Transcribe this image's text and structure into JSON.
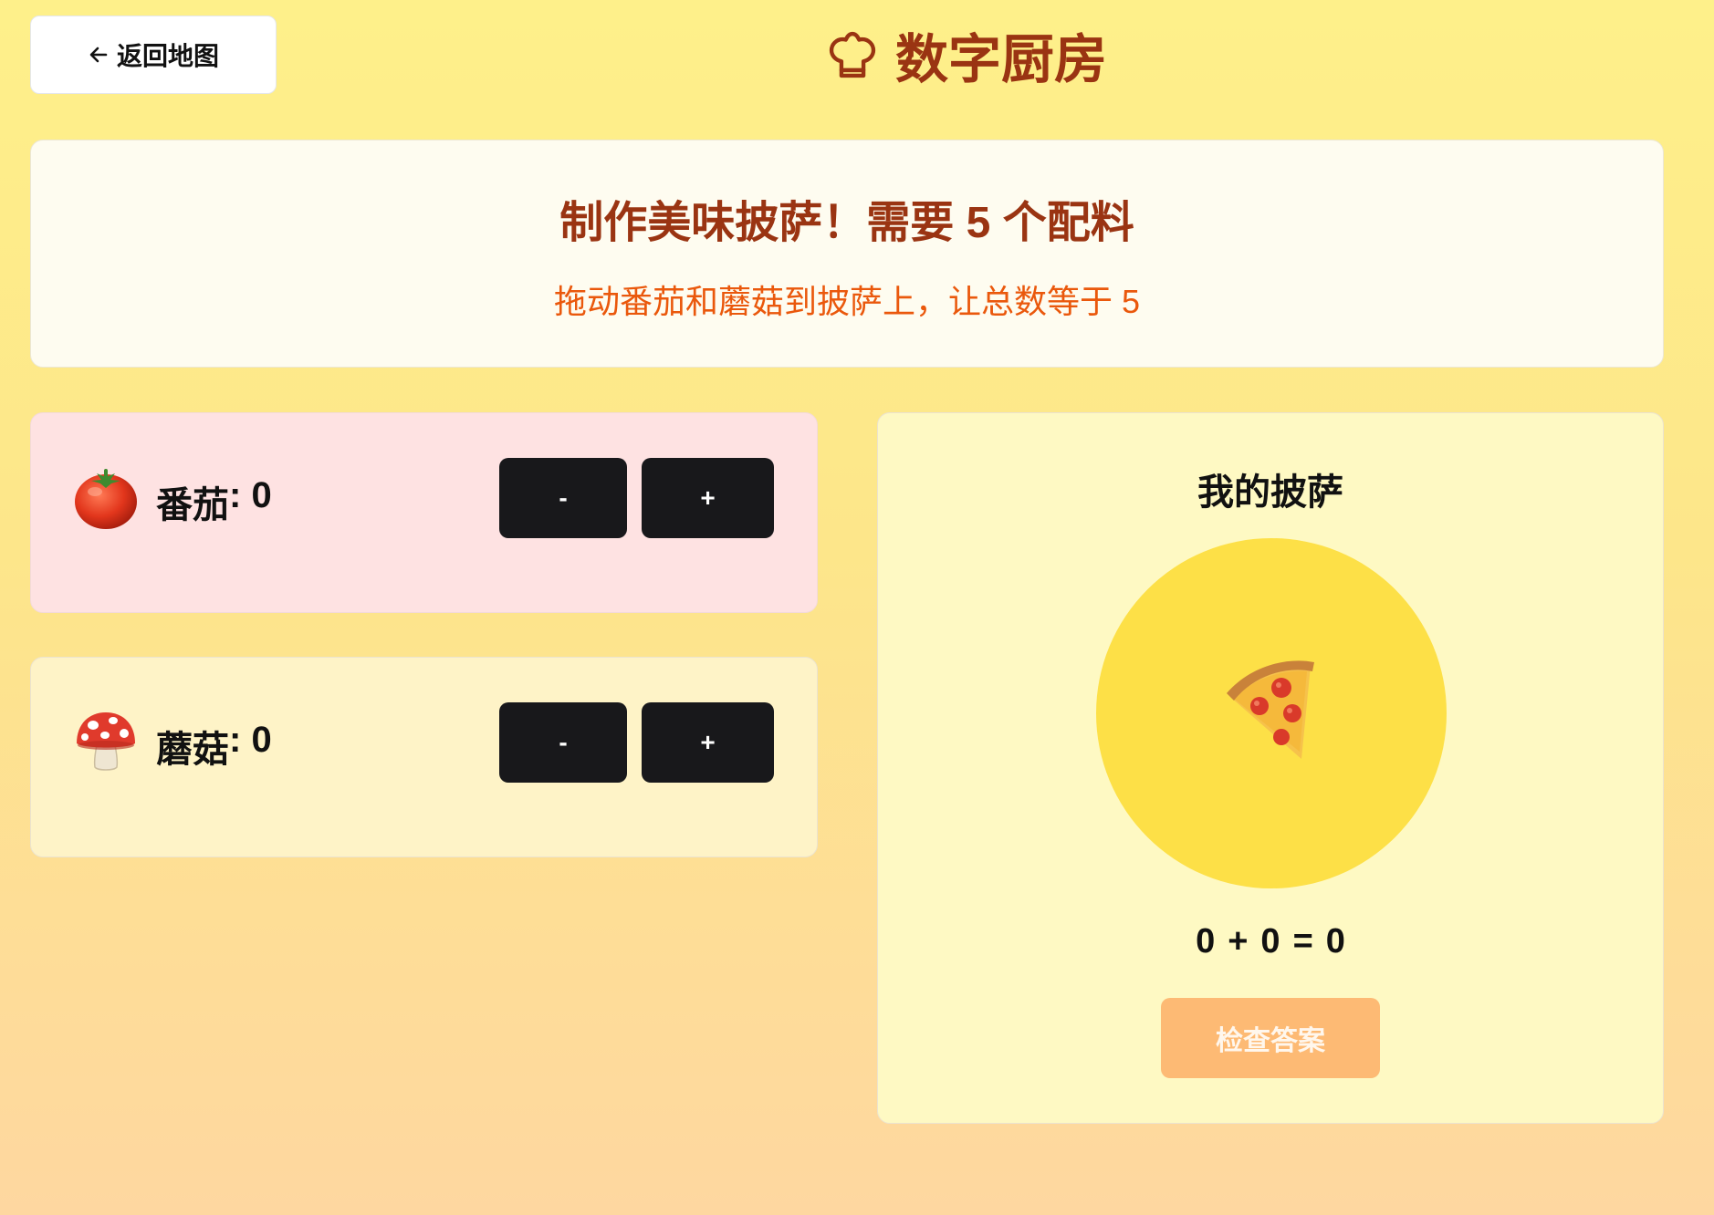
{
  "header": {
    "back_label": "返回地图",
    "title": "数字厨房"
  },
  "intro": {
    "goal_prefix": "制作美味披萨！需要",
    "goal_target": "5",
    "goal_suffix": "个配料",
    "hint": "拖动番茄和蘑菇到披萨上，让总数等于 5"
  },
  "ingredients": [
    {
      "name": "番茄",
      "icon": "tomato-icon",
      "count": "0",
      "minus_label": "-",
      "plus_label": "+"
    },
    {
      "name": "蘑菇",
      "icon": "mushroom-icon",
      "count": "0",
      "minus_label": "-",
      "plus_label": "+"
    }
  ],
  "pizza": {
    "title": "我的披萨",
    "icon": "pizza-icon",
    "equation": {
      "a": "0",
      "plus": "+",
      "b": "0",
      "equals": "=",
      "total": "0"
    },
    "check_label": "检查答案"
  },
  "colors": {
    "title": "#9a3412",
    "hint": "#ea580c",
    "button_dark": "#18181b",
    "check_button": "#fdba74",
    "plate": "#fde047",
    "tomato_card": "#fee2e2",
    "mushroom_card": "#fef3c7",
    "pizza_card": "#fef9c3"
  }
}
